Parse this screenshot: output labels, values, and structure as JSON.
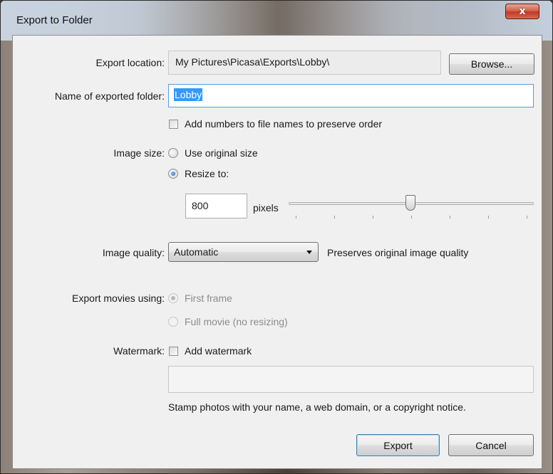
{
  "window": {
    "title": "Export to Folder",
    "close_glyph": "x"
  },
  "export_location": {
    "label": "Export location:",
    "value": "My Pictures\\Picasa\\Exports\\Lobby\\",
    "browse_label": "Browse..."
  },
  "folder_name": {
    "label": "Name of exported folder:",
    "value": "Lobby"
  },
  "add_numbers": {
    "label": "Add numbers to file names to preserve order",
    "checked": false
  },
  "image_size": {
    "label": "Image size:",
    "options": [
      {
        "label": "Use original size",
        "selected": false
      },
      {
        "label": "Resize to:",
        "selected": true
      }
    ],
    "pixels_value": "800",
    "pixels_unit": "pixels"
  },
  "image_quality": {
    "label": "Image quality:",
    "selected": "Automatic",
    "description": "Preserves original image quality"
  },
  "export_movies": {
    "label": "Export movies using:",
    "options": [
      {
        "label": "First frame",
        "selected": true
      },
      {
        "label": "Full movie (no resizing)",
        "selected": false
      }
    ]
  },
  "watermark": {
    "label": "Watermark:",
    "checkbox_label": "Add watermark",
    "checked": false,
    "text_value": "",
    "hint": "Stamp photos with your name, a web domain, or a copyright notice."
  },
  "actions": {
    "export_label": "Export",
    "cancel_label": "Cancel"
  }
}
